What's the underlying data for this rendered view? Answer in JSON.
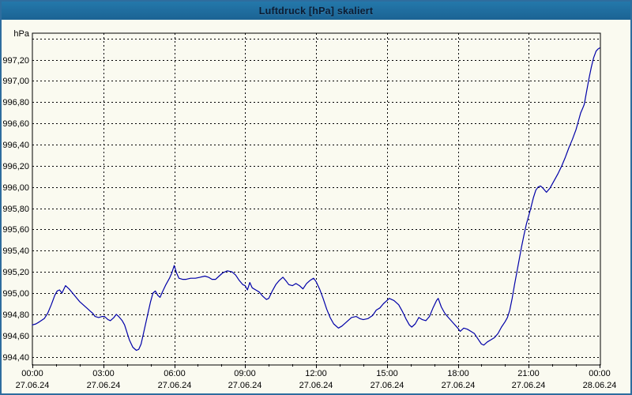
{
  "window": {
    "title": "Luftdruck [hPa] skaliert"
  },
  "chart_data": {
    "type": "line",
    "title": "Luftdruck [hPa] skaliert",
    "grid": "dashed",
    "legend": "none",
    "y_axis": {
      "unit": "hPa",
      "tick_step": 0.2,
      "grid_min": 994.4,
      "grid_max": 997.4,
      "labeled_max": 997.2,
      "decimal_separator": ",",
      "ylim": [
        994.33,
        997.45
      ],
      "tick_labels": [
        "994,40",
        "994,60",
        "994,80",
        "995,00",
        "995,20",
        "995,40",
        "995,60",
        "995,80",
        "996,00",
        "996,20",
        "996,40",
        "996,60",
        "996,80",
        "997,00",
        "997,20"
      ]
    },
    "x_axis": {
      "range_hours": [
        0,
        24
      ],
      "minor_tick_every_hours": 1,
      "major_ticks": [
        {
          "hour": 0,
          "time": "00:00",
          "date": "27.06.24"
        },
        {
          "hour": 3,
          "time": "03:00",
          "date": "27.06.24"
        },
        {
          "hour": 6,
          "time": "06:00",
          "date": "27.06.24"
        },
        {
          "hour": 9,
          "time": "09:00",
          "date": "27.06.24"
        },
        {
          "hour": 12,
          "time": "12:00",
          "date": "27.06.24"
        },
        {
          "hour": 15,
          "time": "15:00",
          "date": "27.06.24"
        },
        {
          "hour": 18,
          "time": "18:00",
          "date": "27.06.24"
        },
        {
          "hour": 21,
          "time": "21:00",
          "date": "27.06.24"
        },
        {
          "hour": 24,
          "time": "00:00",
          "date": "28.06.24"
        }
      ]
    },
    "colors": {
      "line": "#0000a8",
      "grid": "#000000",
      "frame": "#000000"
    },
    "series": [
      {
        "points": [
          [
            0.0,
            994.7
          ],
          [
            0.15,
            994.71
          ],
          [
            0.3,
            994.73
          ],
          [
            0.5,
            994.76
          ],
          [
            0.65,
            994.81
          ],
          [
            0.8,
            994.89
          ],
          [
            0.95,
            994.98
          ],
          [
            1.05,
            995.02
          ],
          [
            1.15,
            995.03
          ],
          [
            1.25,
            995.0
          ],
          [
            1.4,
            995.07
          ],
          [
            1.55,
            995.04
          ],
          [
            1.7,
            995.0
          ],
          [
            1.85,
            994.96
          ],
          [
            2.0,
            994.92
          ],
          [
            2.15,
            994.89
          ],
          [
            2.3,
            994.86
          ],
          [
            2.45,
            994.83
          ],
          [
            2.55,
            994.81
          ],
          [
            2.65,
            994.78
          ],
          [
            2.8,
            994.77
          ],
          [
            2.95,
            994.78
          ],
          [
            3.05,
            994.78
          ],
          [
            3.2,
            994.75
          ],
          [
            3.3,
            994.74
          ],
          [
            3.45,
            994.77
          ],
          [
            3.55,
            994.8
          ],
          [
            3.65,
            994.78
          ],
          [
            3.8,
            994.74
          ],
          [
            3.9,
            994.7
          ],
          [
            4.0,
            994.63
          ],
          [
            4.1,
            994.56
          ],
          [
            4.25,
            994.49
          ],
          [
            4.4,
            994.46
          ],
          [
            4.5,
            994.47
          ],
          [
            4.6,
            994.52
          ],
          [
            4.7,
            994.62
          ],
          [
            4.85,
            994.77
          ],
          [
            5.0,
            994.92
          ],
          [
            5.1,
            995.0
          ],
          [
            5.2,
            995.02
          ],
          [
            5.3,
            994.98
          ],
          [
            5.4,
            994.96
          ],
          [
            5.5,
            995.01
          ],
          [
            5.65,
            995.08
          ],
          [
            5.8,
            995.14
          ],
          [
            5.9,
            995.19
          ],
          [
            6.0,
            995.26
          ],
          [
            6.1,
            995.19
          ],
          [
            6.2,
            995.14
          ],
          [
            6.35,
            995.13
          ],
          [
            6.5,
            995.13
          ],
          [
            6.7,
            995.14
          ],
          [
            6.9,
            995.14
          ],
          [
            7.1,
            995.15
          ],
          [
            7.3,
            995.16
          ],
          [
            7.45,
            995.15
          ],
          [
            7.6,
            995.13
          ],
          [
            7.75,
            995.13
          ],
          [
            7.9,
            995.16
          ],
          [
            8.05,
            995.19
          ],
          [
            8.25,
            995.21
          ],
          [
            8.45,
            995.2
          ],
          [
            8.6,
            995.17
          ],
          [
            8.75,
            995.12
          ],
          [
            8.9,
            995.08
          ],
          [
            9.0,
            995.07
          ],
          [
            9.1,
            995.03
          ],
          [
            9.2,
            995.1
          ],
          [
            9.3,
            995.05
          ],
          [
            9.45,
            995.03
          ],
          [
            9.6,
            995.01
          ],
          [
            9.75,
            994.97
          ],
          [
            9.9,
            994.94
          ],
          [
            10.0,
            994.95
          ],
          [
            10.15,
            995.02
          ],
          [
            10.3,
            995.08
          ],
          [
            10.45,
            995.12
          ],
          [
            10.6,
            995.15
          ],
          [
            10.75,
            995.11
          ],
          [
            10.85,
            995.08
          ],
          [
            11.0,
            995.07
          ],
          [
            11.15,
            995.09
          ],
          [
            11.3,
            995.07
          ],
          [
            11.45,
            995.04
          ],
          [
            11.6,
            995.09
          ],
          [
            11.75,
            995.12
          ],
          [
            11.9,
            995.14
          ],
          [
            12.0,
            995.11
          ],
          [
            12.15,
            995.04
          ],
          [
            12.3,
            994.95
          ],
          [
            12.45,
            994.85
          ],
          [
            12.6,
            994.77
          ],
          [
            12.75,
            994.71
          ],
          [
            12.95,
            994.67
          ],
          [
            13.1,
            994.69
          ],
          [
            13.3,
            994.73
          ],
          [
            13.5,
            994.77
          ],
          [
            13.7,
            994.78
          ],
          [
            13.85,
            994.76
          ],
          [
            14.0,
            994.75
          ],
          [
            14.2,
            994.76
          ],
          [
            14.4,
            994.79
          ],
          [
            14.55,
            994.84
          ],
          [
            14.7,
            994.86
          ],
          [
            14.85,
            994.9
          ],
          [
            15.0,
            994.93
          ],
          [
            15.1,
            994.95
          ],
          [
            15.3,
            994.93
          ],
          [
            15.5,
            994.89
          ],
          [
            15.65,
            994.83
          ],
          [
            15.8,
            994.76
          ],
          [
            15.95,
            994.7
          ],
          [
            16.05,
            994.68
          ],
          [
            16.2,
            994.71
          ],
          [
            16.35,
            994.77
          ],
          [
            16.5,
            994.75
          ],
          [
            16.65,
            994.74
          ],
          [
            16.8,
            994.78
          ],
          [
            16.95,
            994.86
          ],
          [
            17.1,
            994.93
          ],
          [
            17.17,
            994.95
          ],
          [
            17.3,
            994.87
          ],
          [
            17.45,
            994.81
          ],
          [
            17.6,
            994.77
          ],
          [
            17.8,
            994.72
          ],
          [
            18.0,
            994.67
          ],
          [
            18.1,
            994.64
          ],
          [
            18.25,
            994.67
          ],
          [
            18.4,
            994.66
          ],
          [
            18.55,
            994.64
          ],
          [
            18.7,
            994.62
          ],
          [
            18.85,
            994.57
          ],
          [
            19.0,
            994.52
          ],
          [
            19.1,
            994.51
          ],
          [
            19.25,
            994.54
          ],
          [
            19.4,
            994.56
          ],
          [
            19.55,
            994.58
          ],
          [
            19.7,
            994.62
          ],
          [
            19.85,
            994.68
          ],
          [
            20.0,
            994.73
          ],
          [
            20.1,
            994.77
          ],
          [
            20.2,
            994.84
          ],
          [
            20.3,
            994.95
          ],
          [
            20.4,
            995.08
          ],
          [
            20.5,
            995.2
          ],
          [
            20.6,
            995.32
          ],
          [
            20.7,
            995.44
          ],
          [
            20.8,
            995.55
          ],
          [
            20.9,
            995.65
          ],
          [
            21.0,
            995.73
          ],
          [
            21.1,
            995.81
          ],
          [
            21.2,
            995.9
          ],
          [
            21.3,
            995.97
          ],
          [
            21.4,
            996.0
          ],
          [
            21.5,
            996.01
          ],
          [
            21.6,
            995.99
          ],
          [
            21.75,
            995.95
          ],
          [
            21.9,
            995.99
          ],
          [
            22.0,
            996.03
          ],
          [
            22.1,
            996.07
          ],
          [
            22.25,
            996.13
          ],
          [
            22.4,
            996.2
          ],
          [
            22.55,
            996.28
          ],
          [
            22.7,
            996.37
          ],
          [
            22.85,
            996.45
          ],
          [
            23.0,
            996.54
          ],
          [
            23.1,
            996.62
          ],
          [
            23.2,
            996.7
          ],
          [
            23.28,
            996.74
          ],
          [
            23.35,
            996.78
          ],
          [
            23.45,
            996.9
          ],
          [
            23.55,
            997.02
          ],
          [
            23.65,
            997.13
          ],
          [
            23.75,
            997.22
          ],
          [
            23.85,
            997.28
          ],
          [
            23.93,
            997.3
          ],
          [
            24.0,
            997.31
          ]
        ]
      }
    ]
  }
}
